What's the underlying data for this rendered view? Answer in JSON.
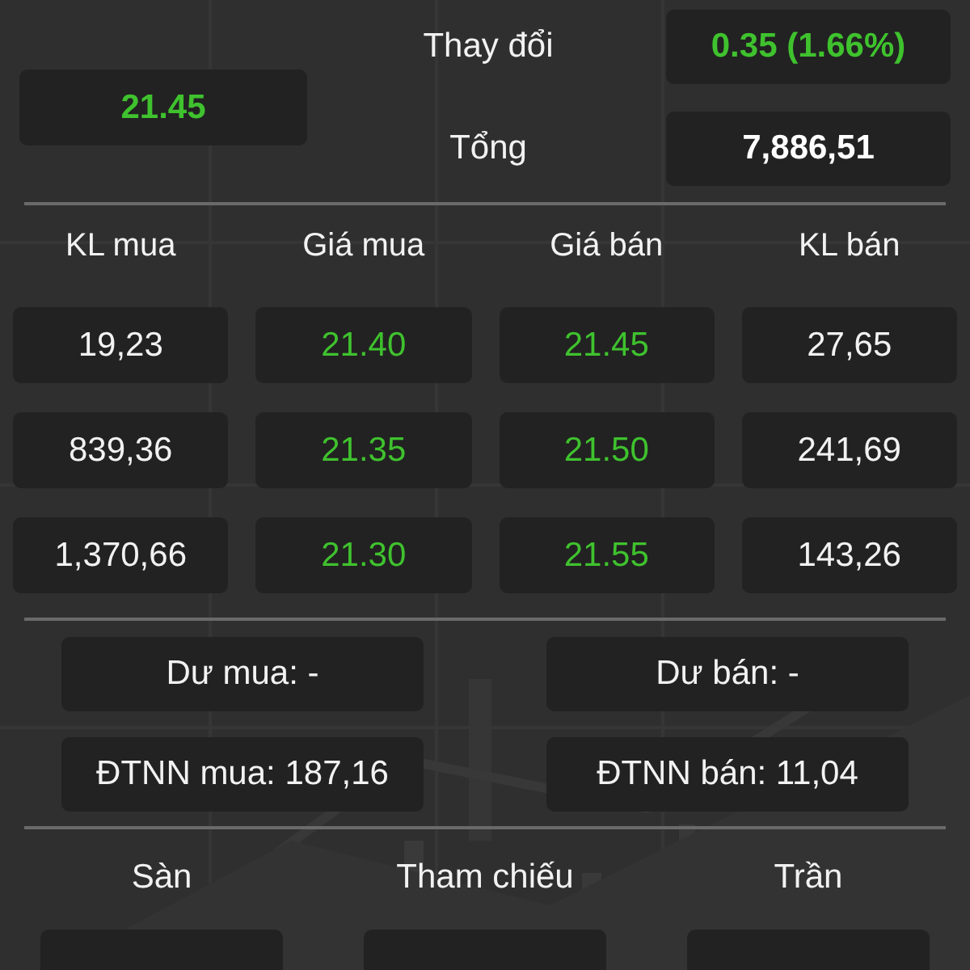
{
  "price": {
    "value": "21.45",
    "rising": true
  },
  "change": {
    "label": "Thay đổi",
    "value": "0.35 (1.66%)",
    "rising": true
  },
  "total": {
    "label": "Tổng",
    "value": "7,886,51"
  },
  "order_book": {
    "columns": [
      "KL mua",
      "Giá mua",
      "Giá bán",
      "KL bán"
    ],
    "rows": [
      [
        {
          "text": "19,23",
          "rising": false
        },
        {
          "text": "21.40",
          "rising": true
        },
        {
          "text": "21.45",
          "rising": true
        },
        {
          "text": "27,65",
          "rising": false
        }
      ],
      [
        {
          "text": "839,36",
          "rising": false
        },
        {
          "text": "21.35",
          "rising": true
        },
        {
          "text": "21.50",
          "rising": true
        },
        {
          "text": "241,69",
          "rising": false
        }
      ],
      [
        {
          "text": "1,370,66",
          "rising": false
        },
        {
          "text": "21.30",
          "rising": true
        },
        {
          "text": "21.55",
          "rising": true
        },
        {
          "text": "143,26",
          "rising": false
        }
      ]
    ]
  },
  "summary": [
    "Dư mua: -",
    "Dư bán: -",
    "ĐTNN mua: 187,16",
    "ĐTNN bán: 11,04"
  ],
  "limits": {
    "columns": [
      "Sàn",
      "Tham chiếu",
      "Trần"
    ]
  }
}
